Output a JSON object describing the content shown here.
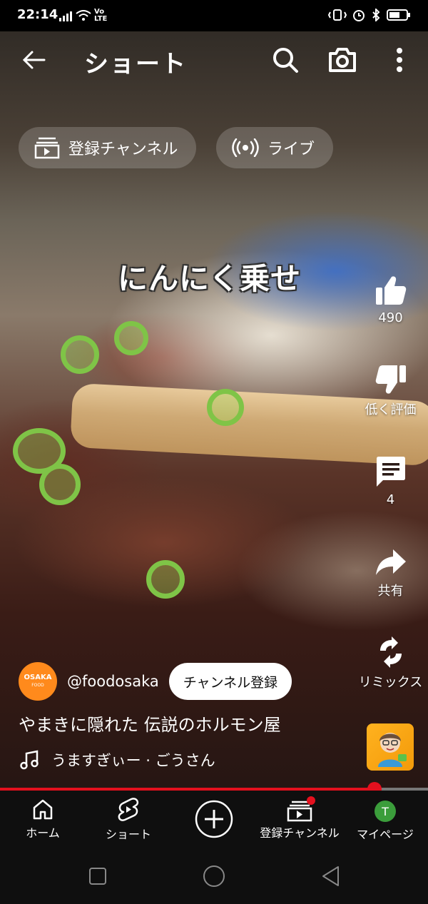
{
  "status_bar": {
    "time": "22:14",
    "volte": "Vo LTE"
  },
  "header": {
    "title": "ショート",
    "icons": [
      "back-arrow-icon",
      "search-icon",
      "camera-icon",
      "more-vert-icon"
    ]
  },
  "chips": [
    {
      "label": "登録チャンネル",
      "icon": "subscriptions-icon"
    },
    {
      "label": "ライブ",
      "icon": "live-icon"
    }
  ],
  "video": {
    "overlay_caption": "にんにく乗せ",
    "progress": 0.875
  },
  "actions": {
    "like": {
      "label": "490",
      "icon": "thumb-up-icon"
    },
    "dislike": {
      "label": "低く評価",
      "icon": "thumb-down-icon"
    },
    "comments": {
      "label": "4",
      "icon": "comment-icon"
    },
    "share": {
      "label": "共有",
      "icon": "share-icon"
    },
    "remix": {
      "label": "リミックス",
      "icon": "remix-icon"
    }
  },
  "channel": {
    "avatar_text": "OSAKA",
    "avatar_sub": "FOOD",
    "handle": "@foodosaka",
    "subscribe_label": "チャンネル登録"
  },
  "video_title": "やまきに隠れた 伝説のホルモン屋",
  "music": {
    "text": "うますぎぃー · ごうさん",
    "icon": "music-note-icon"
  },
  "nav": [
    {
      "label": "ホーム",
      "icon": "home-icon"
    },
    {
      "label": "ショート",
      "icon": "shorts-icon"
    },
    {
      "label": "",
      "icon": "create-plus-icon"
    },
    {
      "label": "登録チャンネル",
      "icon": "subscriptions-icon"
    },
    {
      "label": "マイページ",
      "icon": "avatar",
      "avatar_letter": "T"
    }
  ],
  "colors": {
    "accent_red": "#e4101e",
    "avatar_green": "#3b9d3b",
    "channel_orange": "#ff8a1c"
  }
}
